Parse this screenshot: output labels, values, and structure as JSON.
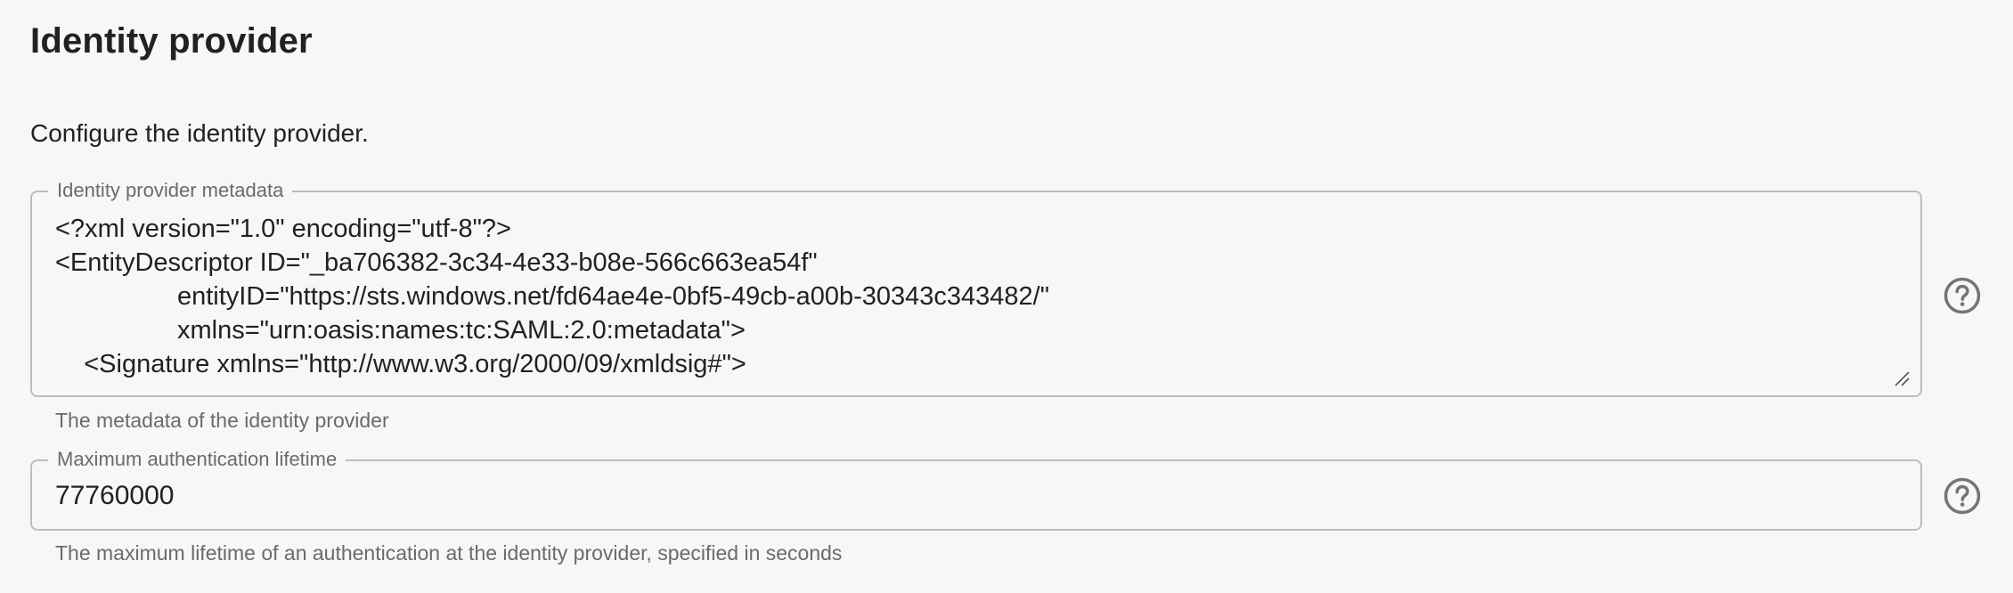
{
  "section": {
    "title": "Identity provider",
    "description": "Configure the identity provider."
  },
  "metadata_field": {
    "label": "Identity provider metadata",
    "value": "<?xml version=\"1.0\" encoding=\"utf-8\"?>\n<EntityDescriptor ID=\"_ba706382-3c34-4e33-b08e-566c663ea54f\"\n                 entityID=\"https://sts.windows.net/fd64ae4e-0bf5-49cb-a00b-30343c343482/\"\n                 xmlns=\"urn:oasis:names:tc:SAML:2.0:metadata\">\n    <Signature xmlns=\"http://www.w3.org/2000/09/xmldsig#\">",
    "hint": "The metadata of the identity provider",
    "help_icon": "help-circle-icon"
  },
  "lifetime_field": {
    "label": "Maximum authentication lifetime",
    "value": "77760000",
    "hint": "The maximum lifetime of an authentication at the identity provider, specified in seconds",
    "help_icon": "help-circle-icon"
  },
  "colors": {
    "background": "#f7f7f7",
    "border": "#bdbdbd",
    "label": "#6b6b6b",
    "text": "#212121",
    "icon": "#757575"
  }
}
